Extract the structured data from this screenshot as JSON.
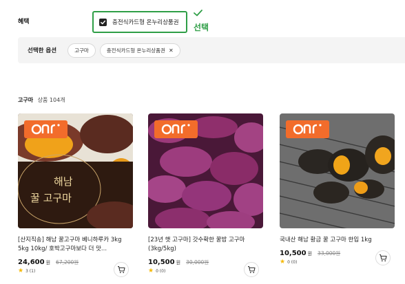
{
  "benefit": {
    "label": "혜택",
    "option_label": "충전식카드형 온누리상품권",
    "annotation": "선택"
  },
  "selected": {
    "label": "선택한 옵션",
    "chips": [
      "고구마",
      "충전식카드형 온누리상품권"
    ]
  },
  "category": {
    "name": "고구마",
    "count": "상품 104개"
  },
  "products": [
    {
      "badge": "onnuri-logo",
      "title": "[산지직송] 해남 꿀고구마 베니하루카 3kg 5kg 10kg/ 호박고구마보다 더 맛...",
      "price": "24,600",
      "won": "원",
      "old_price": "67,200원",
      "rating": "3 (1)",
      "image_text_1": "해남",
      "image_text_2": "꿀 고구마"
    },
    {
      "badge": "onnuri-logo",
      "title": "[23년 햇 고구마] 갓수확한 꿀밤 고구마 (3kg/5kg)",
      "price": "10,500",
      "won": "원",
      "old_price": "30,000원",
      "rating": "0 (0)"
    },
    {
      "badge": "onnuri-logo",
      "title": "국내산 해남 황금 꿀 고구마 한입 1kg",
      "price": "10,500",
      "won": "원",
      "old_price": "33,000원",
      "rating": "0 (0)"
    }
  ],
  "colors": {
    "accent_green": "#2e9e46",
    "badge_orange": "#f26c2b",
    "star": "#f5b800"
  }
}
